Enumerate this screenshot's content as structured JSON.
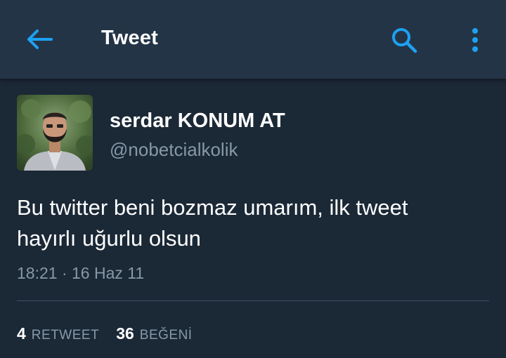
{
  "header": {
    "title": "Tweet",
    "back_icon": "arrow-left-icon",
    "search_icon": "search-icon",
    "more_icon": "more-vertical-icon",
    "accent_color": "#1da1f2",
    "background_color": "#243447"
  },
  "tweet": {
    "author_name": "serdar KONUM AT",
    "handle": "@nobetcialkolik",
    "text_line1": "Bu twitter beni bozmaz umarım, ilk tweet",
    "text_line2": "hayırlı uğurlu olsun",
    "timestamp": "18:21 · 16 Haz 11"
  },
  "stats": {
    "retweet_count": "4",
    "retweet_label": "RETWEET",
    "like_count": "36",
    "like_label": "BEĞENİ"
  },
  "colors": {
    "page_background": "#1b2836",
    "secondary_text": "#8899a6",
    "divider": "#3d5166"
  }
}
